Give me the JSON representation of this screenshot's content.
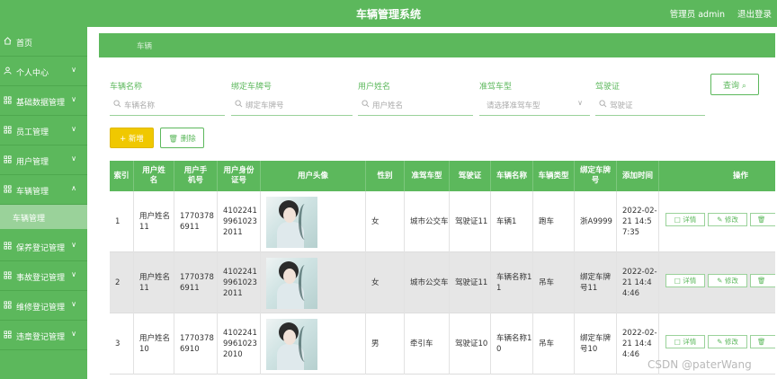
{
  "app": {
    "title": "车辆管理系统",
    "admin_label": "管理员 admin",
    "logout_label": "退出登录"
  },
  "sidebar": {
    "items": [
      {
        "label": "首页",
        "icon": "home-icon",
        "has_children": false
      },
      {
        "label": "个人中心",
        "icon": "user-icon",
        "has_children": true
      },
      {
        "label": "基础数据管理",
        "icon": "grid-icon",
        "has_children": true
      },
      {
        "label": "员工管理",
        "icon": "grid-icon",
        "has_children": true
      },
      {
        "label": "用户管理",
        "icon": "grid-icon",
        "has_children": true
      },
      {
        "label": "车辆管理",
        "icon": "grid-icon",
        "has_children": true
      },
      {
        "label": "保养登记管理",
        "icon": "grid-icon",
        "has_children": true
      },
      {
        "label": "事故登记管理",
        "icon": "grid-icon",
        "has_children": true
      },
      {
        "label": "维修登记管理",
        "icon": "grid-icon",
        "has_children": true
      },
      {
        "label": "违章登记管理",
        "icon": "grid-icon",
        "has_children": true
      }
    ],
    "active_sub": "车辆管理",
    "chevron": "∨"
  },
  "breadcrumb": {
    "label": "车辆"
  },
  "filters": [
    {
      "label": "车辆名称",
      "placeholder": "车辆名称",
      "type": "input"
    },
    {
      "label": "绑定车牌号",
      "placeholder": "绑定车牌号",
      "type": "input"
    },
    {
      "label": "用户姓名",
      "placeholder": "用户姓名",
      "type": "input"
    },
    {
      "label": "准驾车型",
      "placeholder": "请选择准驾车型",
      "type": "select"
    },
    {
      "label": "驾驶证",
      "placeholder": "驾驶证",
      "type": "input"
    }
  ],
  "buttons": {
    "search": "查询",
    "add": "新增",
    "delete": "删除",
    "detail": "详情",
    "edit": "修改"
  },
  "table": {
    "columns": [
      "索引",
      "用户姓名",
      "用户手机号",
      "用户身份证号",
      "用户头像",
      "性别",
      "准驾车型",
      "驾驶证",
      "车辆名称",
      "车辆类型",
      "绑定车牌号",
      "添加时间",
      "操作"
    ],
    "rows": [
      {
        "index": "1",
        "name": "用户姓名11",
        "phone": "17703786911",
        "id_card": "410224199610232011",
        "gender": "女",
        "license_type": "城市公交车",
        "license": "驾驶证11",
        "car_name": "车辆1",
        "car_type": "跑车",
        "plate": "浙A9999",
        "time": "2022-02-21 14:57:35"
      },
      {
        "index": "2",
        "name": "用户姓名11",
        "phone": "17703786911",
        "id_card": "410224199610232011",
        "gender": "女",
        "license_type": "城市公交车",
        "license": "驾驶证11",
        "car_name": "车辆名称11",
        "car_type": "吊车",
        "plate": "绑定车牌号11",
        "time": "2022-02-21 14:44:46"
      },
      {
        "index": "3",
        "name": "用户姓名10",
        "phone": "17703786910",
        "id_card": "410224199610232010",
        "gender": "男",
        "license_type": "牵引车",
        "license": "驾驶证10",
        "car_name": "车辆名称10",
        "car_type": "吊车",
        "plate": "绑定车牌号10",
        "time": "2022-02-21 14:44:46"
      }
    ]
  },
  "watermark": "CSDN @paterWang",
  "colors": {
    "primary": "#5cb85c",
    "add_button": "#f0c800"
  }
}
